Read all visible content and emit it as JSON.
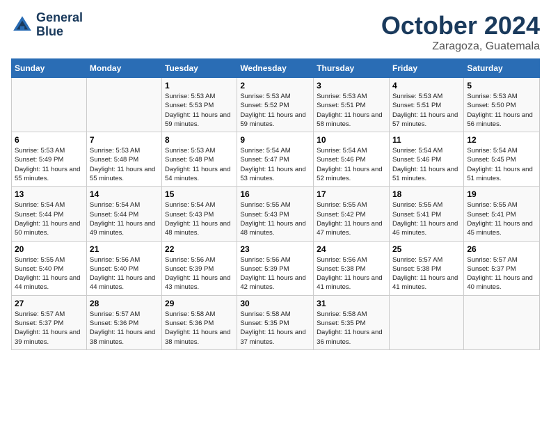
{
  "header": {
    "logo_line1": "General",
    "logo_line2": "Blue",
    "month_title": "October 2024",
    "subtitle": "Zaragoza, Guatemala"
  },
  "weekdays": [
    "Sunday",
    "Monday",
    "Tuesday",
    "Wednesday",
    "Thursday",
    "Friday",
    "Saturday"
  ],
  "weeks": [
    [
      {
        "day": "",
        "sunrise": "",
        "sunset": "",
        "daylight": ""
      },
      {
        "day": "",
        "sunrise": "",
        "sunset": "",
        "daylight": ""
      },
      {
        "day": "1",
        "sunrise": "Sunrise: 5:53 AM",
        "sunset": "Sunset: 5:53 PM",
        "daylight": "Daylight: 11 hours and 59 minutes."
      },
      {
        "day": "2",
        "sunrise": "Sunrise: 5:53 AM",
        "sunset": "Sunset: 5:52 PM",
        "daylight": "Daylight: 11 hours and 59 minutes."
      },
      {
        "day": "3",
        "sunrise": "Sunrise: 5:53 AM",
        "sunset": "Sunset: 5:51 PM",
        "daylight": "Daylight: 11 hours and 58 minutes."
      },
      {
        "day": "4",
        "sunrise": "Sunrise: 5:53 AM",
        "sunset": "Sunset: 5:51 PM",
        "daylight": "Daylight: 11 hours and 57 minutes."
      },
      {
        "day": "5",
        "sunrise": "Sunrise: 5:53 AM",
        "sunset": "Sunset: 5:50 PM",
        "daylight": "Daylight: 11 hours and 56 minutes."
      }
    ],
    [
      {
        "day": "6",
        "sunrise": "Sunrise: 5:53 AM",
        "sunset": "Sunset: 5:49 PM",
        "daylight": "Daylight: 11 hours and 55 minutes."
      },
      {
        "day": "7",
        "sunrise": "Sunrise: 5:53 AM",
        "sunset": "Sunset: 5:48 PM",
        "daylight": "Daylight: 11 hours and 55 minutes."
      },
      {
        "day": "8",
        "sunrise": "Sunrise: 5:53 AM",
        "sunset": "Sunset: 5:48 PM",
        "daylight": "Daylight: 11 hours and 54 minutes."
      },
      {
        "day": "9",
        "sunrise": "Sunrise: 5:54 AM",
        "sunset": "Sunset: 5:47 PM",
        "daylight": "Daylight: 11 hours and 53 minutes."
      },
      {
        "day": "10",
        "sunrise": "Sunrise: 5:54 AM",
        "sunset": "Sunset: 5:46 PM",
        "daylight": "Daylight: 11 hours and 52 minutes."
      },
      {
        "day": "11",
        "sunrise": "Sunrise: 5:54 AM",
        "sunset": "Sunset: 5:46 PM",
        "daylight": "Daylight: 11 hours and 51 minutes."
      },
      {
        "day": "12",
        "sunrise": "Sunrise: 5:54 AM",
        "sunset": "Sunset: 5:45 PM",
        "daylight": "Daylight: 11 hours and 51 minutes."
      }
    ],
    [
      {
        "day": "13",
        "sunrise": "Sunrise: 5:54 AM",
        "sunset": "Sunset: 5:44 PM",
        "daylight": "Daylight: 11 hours and 50 minutes."
      },
      {
        "day": "14",
        "sunrise": "Sunrise: 5:54 AM",
        "sunset": "Sunset: 5:44 PM",
        "daylight": "Daylight: 11 hours and 49 minutes."
      },
      {
        "day": "15",
        "sunrise": "Sunrise: 5:54 AM",
        "sunset": "Sunset: 5:43 PM",
        "daylight": "Daylight: 11 hours and 48 minutes."
      },
      {
        "day": "16",
        "sunrise": "Sunrise: 5:55 AM",
        "sunset": "Sunset: 5:43 PM",
        "daylight": "Daylight: 11 hours and 48 minutes."
      },
      {
        "day": "17",
        "sunrise": "Sunrise: 5:55 AM",
        "sunset": "Sunset: 5:42 PM",
        "daylight": "Daylight: 11 hours and 47 minutes."
      },
      {
        "day": "18",
        "sunrise": "Sunrise: 5:55 AM",
        "sunset": "Sunset: 5:41 PM",
        "daylight": "Daylight: 11 hours and 46 minutes."
      },
      {
        "day": "19",
        "sunrise": "Sunrise: 5:55 AM",
        "sunset": "Sunset: 5:41 PM",
        "daylight": "Daylight: 11 hours and 45 minutes."
      }
    ],
    [
      {
        "day": "20",
        "sunrise": "Sunrise: 5:55 AM",
        "sunset": "Sunset: 5:40 PM",
        "daylight": "Daylight: 11 hours and 44 minutes."
      },
      {
        "day": "21",
        "sunrise": "Sunrise: 5:56 AM",
        "sunset": "Sunset: 5:40 PM",
        "daylight": "Daylight: 11 hours and 44 minutes."
      },
      {
        "day": "22",
        "sunrise": "Sunrise: 5:56 AM",
        "sunset": "Sunset: 5:39 PM",
        "daylight": "Daylight: 11 hours and 43 minutes."
      },
      {
        "day": "23",
        "sunrise": "Sunrise: 5:56 AM",
        "sunset": "Sunset: 5:39 PM",
        "daylight": "Daylight: 11 hours and 42 minutes."
      },
      {
        "day": "24",
        "sunrise": "Sunrise: 5:56 AM",
        "sunset": "Sunset: 5:38 PM",
        "daylight": "Daylight: 11 hours and 41 minutes."
      },
      {
        "day": "25",
        "sunrise": "Sunrise: 5:57 AM",
        "sunset": "Sunset: 5:38 PM",
        "daylight": "Daylight: 11 hours and 41 minutes."
      },
      {
        "day": "26",
        "sunrise": "Sunrise: 5:57 AM",
        "sunset": "Sunset: 5:37 PM",
        "daylight": "Daylight: 11 hours and 40 minutes."
      }
    ],
    [
      {
        "day": "27",
        "sunrise": "Sunrise: 5:57 AM",
        "sunset": "Sunset: 5:37 PM",
        "daylight": "Daylight: 11 hours and 39 minutes."
      },
      {
        "day": "28",
        "sunrise": "Sunrise: 5:57 AM",
        "sunset": "Sunset: 5:36 PM",
        "daylight": "Daylight: 11 hours and 38 minutes."
      },
      {
        "day": "29",
        "sunrise": "Sunrise: 5:58 AM",
        "sunset": "Sunset: 5:36 PM",
        "daylight": "Daylight: 11 hours and 38 minutes."
      },
      {
        "day": "30",
        "sunrise": "Sunrise: 5:58 AM",
        "sunset": "Sunset: 5:35 PM",
        "daylight": "Daylight: 11 hours and 37 minutes."
      },
      {
        "day": "31",
        "sunrise": "Sunrise: 5:58 AM",
        "sunset": "Sunset: 5:35 PM",
        "daylight": "Daylight: 11 hours and 36 minutes."
      },
      {
        "day": "",
        "sunrise": "",
        "sunset": "",
        "daylight": ""
      },
      {
        "day": "",
        "sunrise": "",
        "sunset": "",
        "daylight": ""
      }
    ]
  ]
}
